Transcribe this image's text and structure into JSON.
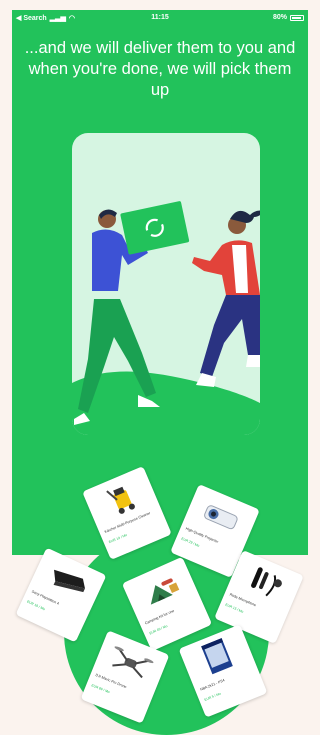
{
  "status_bar": {
    "back_label": "◀ Search",
    "time": "11:15",
    "battery": "80%"
  },
  "headline": "...and we will deliver them to you and when you're done, we will pick them up",
  "colors": {
    "brand_green": "#22c25b",
    "card_bg": "#d6f5e2",
    "page_bg": "#fbf3ee"
  },
  "products": [
    {
      "name": "Kärcher Multi-Purpose Cleaner",
      "price": "EUR 19 / Mo",
      "icon": "vacuum-icon"
    },
    {
      "name": "High-Quality Projector",
      "price": "EUR 29 / Mo",
      "icon": "projector-icon"
    },
    {
      "name": "Sony Playstation 4",
      "price": "EUR 19 / Mo",
      "icon": "console-icon"
    },
    {
      "name": "Camping Kit for one",
      "price": "EUR 49 / Mo",
      "icon": "tent-icon"
    },
    {
      "name": "Rode Microphone",
      "price": "EUR 15 / Mo",
      "icon": "microphone-icon"
    },
    {
      "name": "DJI Mavic Pro Drone",
      "price": "EUR 89 / Mo",
      "icon": "drone-icon"
    },
    {
      "name": "NBA 2k21 - PS4",
      "price": "EUR 5 / Mo",
      "icon": "game-disc-icon"
    }
  ]
}
